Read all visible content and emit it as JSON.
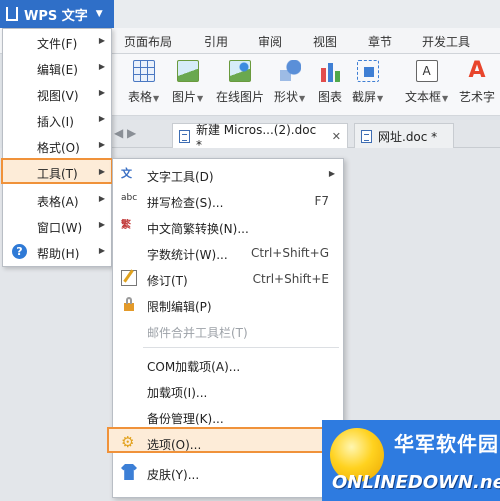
{
  "app": {
    "title": "WPS 文字"
  },
  "ribbon_tabs": [
    "页面布局",
    "引用",
    "审阅",
    "视图",
    "章节",
    "开发工具"
  ],
  "toolbar": [
    {
      "label": "表格",
      "icon": "table-icon"
    },
    {
      "label": "图片",
      "icon": "picture-icon"
    },
    {
      "label": "在线图片",
      "icon": "online-picture-icon"
    },
    {
      "label": "形状",
      "icon": "shapes-icon"
    },
    {
      "label": "图表",
      "icon": "chart-icon"
    },
    {
      "label": "截屏",
      "icon": "screenshot-icon"
    },
    {
      "label": "文本框",
      "icon": "textbox-icon"
    },
    {
      "label": "艺术字",
      "icon": "wordart-icon"
    }
  ],
  "doc_tabs": [
    {
      "label": "新建 Micros...(2).doc *",
      "close": "✕"
    },
    {
      "label": "网址.doc *"
    }
  ],
  "main_menu": [
    {
      "label": "文件(F)"
    },
    {
      "label": "编辑(E)"
    },
    {
      "label": "视图(V)"
    },
    {
      "label": "插入(I)"
    },
    {
      "label": "格式(O)"
    },
    {
      "label": "工具(T)"
    },
    {
      "label": "表格(A)"
    },
    {
      "label": "窗口(W)"
    },
    {
      "label": "帮助(H)"
    }
  ],
  "tools_submenu": [
    {
      "label": "文字工具(D)",
      "icon": "text-tool-icon",
      "has_submenu": true
    },
    {
      "label": "拼写检查(S)...",
      "shortcut": "F7",
      "icon": "spellcheck-icon"
    },
    {
      "label": "中文简繁转换(N)...",
      "icon": "chinese-convert-icon"
    },
    {
      "label": "字数统计(W)...",
      "shortcut": "Ctrl+Shift+G"
    },
    {
      "label": "修订(T)",
      "shortcut": "Ctrl+Shift+E",
      "icon": "revision-icon"
    },
    {
      "label": "限制编辑(P)",
      "icon": "lock-icon"
    },
    {
      "label": "邮件合并工具栏(T)",
      "disabled": true
    },
    {
      "label": "COM加载项(A)..."
    },
    {
      "label": "加载项(I)..."
    },
    {
      "label": "备份管理(K)..."
    },
    {
      "label": "选项(O)...",
      "icon": "gear-icon"
    },
    {
      "label": "皮肤(Y)...",
      "icon": "shirt-icon"
    }
  ],
  "watermark": {
    "cn": "华军软件园",
    "en": "ONLINEDOWN.net"
  },
  "colors": {
    "accent_blue": "#2f6fc8",
    "highlight_orange": "#f0923a",
    "highlight_bg": "#fdecd8"
  }
}
